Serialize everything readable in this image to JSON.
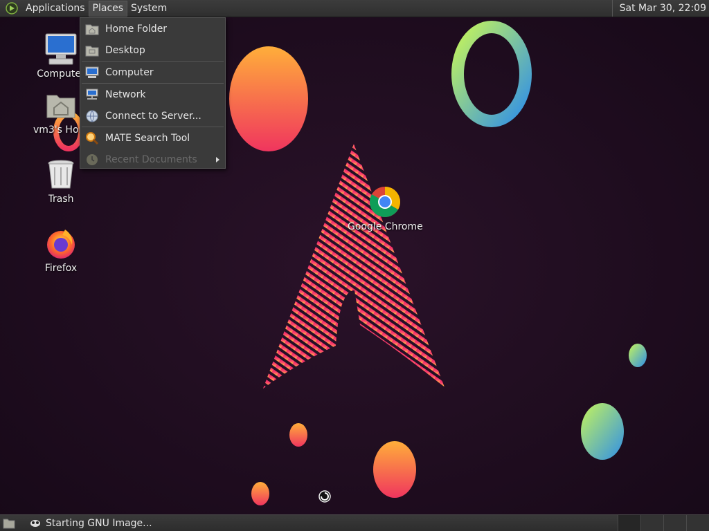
{
  "top_panel": {
    "menus": [
      "Applications",
      "Places",
      "System"
    ],
    "active_menu": "Places",
    "clock": "Sat Mar 30, 22:09"
  },
  "places_menu": {
    "items": [
      {
        "label": "Home Folder",
        "icon": "home-folder-icon",
        "enabled": true
      },
      {
        "label": "Desktop",
        "icon": "desktop-folder-icon",
        "enabled": true
      },
      {
        "label": "Computer",
        "icon": "computer-icon",
        "enabled": true
      },
      {
        "label": "Network",
        "icon": "network-icon",
        "enabled": true
      },
      {
        "label": "Connect to Server...",
        "icon": "connect-server-icon",
        "enabled": true
      },
      {
        "label": "MATE Search Tool",
        "icon": "search-tool-icon",
        "enabled": true
      },
      {
        "label": "Recent Documents",
        "icon": "recent-documents-icon",
        "enabled": false
      }
    ]
  },
  "desktop_icons": [
    {
      "label": "Computer",
      "icon": "computer-icon"
    },
    {
      "label": "vm3's Home",
      "icon": "home-folder-icon"
    },
    {
      "label": "Trash",
      "icon": "trash-icon"
    },
    {
      "label": "Firefox",
      "icon": "firefox-icon"
    },
    {
      "label": "Google Chrome",
      "icon": "chrome-icon"
    }
  ],
  "bottom_panel": {
    "task_label": "Starting GNU Image...",
    "workspaces": 4
  },
  "colors": {
    "wallpaper_bg": "#1e0c1f",
    "panel_bg": "#333333",
    "menu_bg": "#3a3a3a",
    "accent_pink": "#e8336d",
    "accent_orange": "#ffa53a",
    "accent_green": "#b8f05a",
    "accent_blue": "#3b8fe8"
  }
}
